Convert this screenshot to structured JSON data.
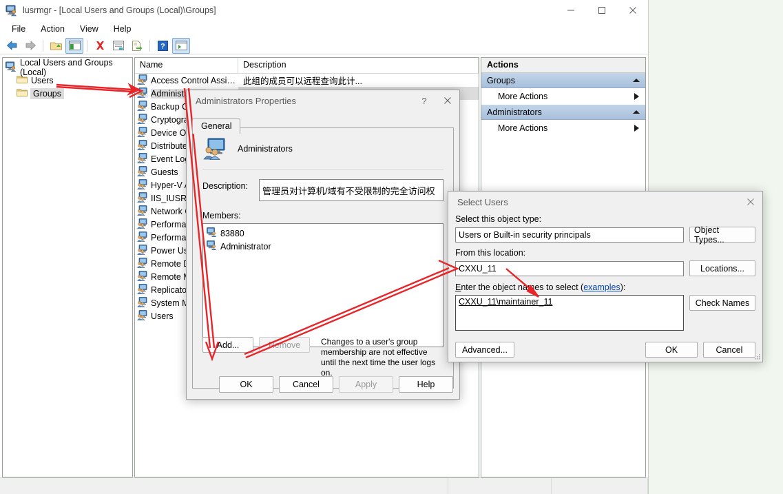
{
  "window": {
    "title": "lusrmgr - [Local Users and Groups (Local)\\Groups]",
    "icon": "computer-users-icon",
    "minimize": "—",
    "maximize": "☐",
    "close": "✕"
  },
  "menu": {
    "items": [
      "File",
      "Action",
      "View",
      "Help"
    ]
  },
  "toolbar": {
    "items": [
      {
        "name": "back-icon",
        "glyph": "←"
      },
      {
        "name": "forward-icon",
        "glyph": "→"
      },
      {
        "name": "up-folder-icon",
        "glyph": "↑"
      },
      {
        "name": "show-hide-tree-icon",
        "glyph": "▤"
      },
      {
        "name": "delete-icon",
        "glyph": "✕"
      },
      {
        "name": "properties-icon",
        "glyph": "▤"
      },
      {
        "name": "export-list-icon",
        "glyph": "↗"
      },
      {
        "name": "help-icon",
        "glyph": "?"
      },
      {
        "name": "show-action-pane-icon",
        "glyph": "▤"
      }
    ]
  },
  "tree": {
    "root": {
      "label": "Local Users and Groups (Local)",
      "icon": "computer-icon"
    },
    "children": [
      {
        "label": "Users",
        "icon": "folder-icon",
        "selected": false
      },
      {
        "label": "Groups",
        "icon": "folder-icon",
        "selected": true
      }
    ]
  },
  "list": {
    "columns": [
      "Name",
      "Description"
    ],
    "rows": [
      {
        "name": "Access Control Assist...",
        "description": "此组的成员可以远程查询此计..."
      },
      {
        "name": "Administrators",
        "description": "管理员对计算机/域有不受限制..."
      },
      {
        "name": "Backup Operators",
        "description": ""
      },
      {
        "name": "Cryptographic Operat...",
        "description": ""
      },
      {
        "name": "Device Owners",
        "description": ""
      },
      {
        "name": "Distributed COM Users",
        "description": ""
      },
      {
        "name": "Event Log Readers",
        "description": ""
      },
      {
        "name": "Guests",
        "description": ""
      },
      {
        "name": "Hyper-V Administrators",
        "description": ""
      },
      {
        "name": "IIS_IUSRS",
        "description": ""
      },
      {
        "name": "Network Configuratio...",
        "description": ""
      },
      {
        "name": "Performance Log Users",
        "description": ""
      },
      {
        "name": "Performance Monitor ...",
        "description": ""
      },
      {
        "name": "Power Users",
        "description": ""
      },
      {
        "name": "Remote Desktop Users",
        "description": ""
      },
      {
        "name": "Remote Management...",
        "description": ""
      },
      {
        "name": "Replicator",
        "description": ""
      },
      {
        "name": "System Managed Acc...",
        "description": ""
      },
      {
        "name": "Users",
        "description": ""
      }
    ]
  },
  "actions": {
    "title": "Actions",
    "groups": [
      {
        "header": "Groups",
        "items": [
          "More Actions"
        ]
      },
      {
        "header": "Administrators",
        "items": [
          "More Actions"
        ]
      }
    ]
  },
  "properties_dialog": {
    "title": "Administrators Properties",
    "help_glyph": "?",
    "close_glyph": "✕",
    "tab": "General",
    "group_name": "Administrators",
    "description_label": "Description:",
    "description_value": "管理员对计算机/域有不受限制的完全访问权",
    "members_label": "Members:",
    "members": [
      "83880",
      "Administrator"
    ],
    "add_button": "Add...",
    "remove_button": "Remove",
    "note": "Changes to a user's group membership are not effective until the next time the user logs on.",
    "ok": "OK",
    "cancel": "Cancel",
    "apply": "Apply",
    "help": "Help"
  },
  "select_users_dialog": {
    "title": "Select Users",
    "close_glyph": "✕",
    "object_type_label": "Select this object type:",
    "object_type_value": "Users or Built-in security principals",
    "object_types_button": "Object Types...",
    "location_label": "From this location:",
    "location_value": "CXXU_11",
    "locations_button": "Locations...",
    "enter_names_label_prefix": "E",
    "enter_names_label_a": "nter the object names to select (",
    "enter_names_link": "examples",
    "enter_names_label_b": "):",
    "names_value": "CXXU_11\\maintainer_11",
    "check_names_button": "Check Names",
    "advanced_button": "Advanced...",
    "ok": "OK",
    "cancel": "Cancel"
  },
  "annotations": {
    "color": "#e8262a",
    "arrows": [
      {
        "name": "arrow-groups-to-list"
      },
      {
        "name": "arrow-administrators-to-add"
      },
      {
        "name": "arrow-add-to-select-users"
      },
      {
        "name": "arrow-to-object-names"
      }
    ]
  }
}
